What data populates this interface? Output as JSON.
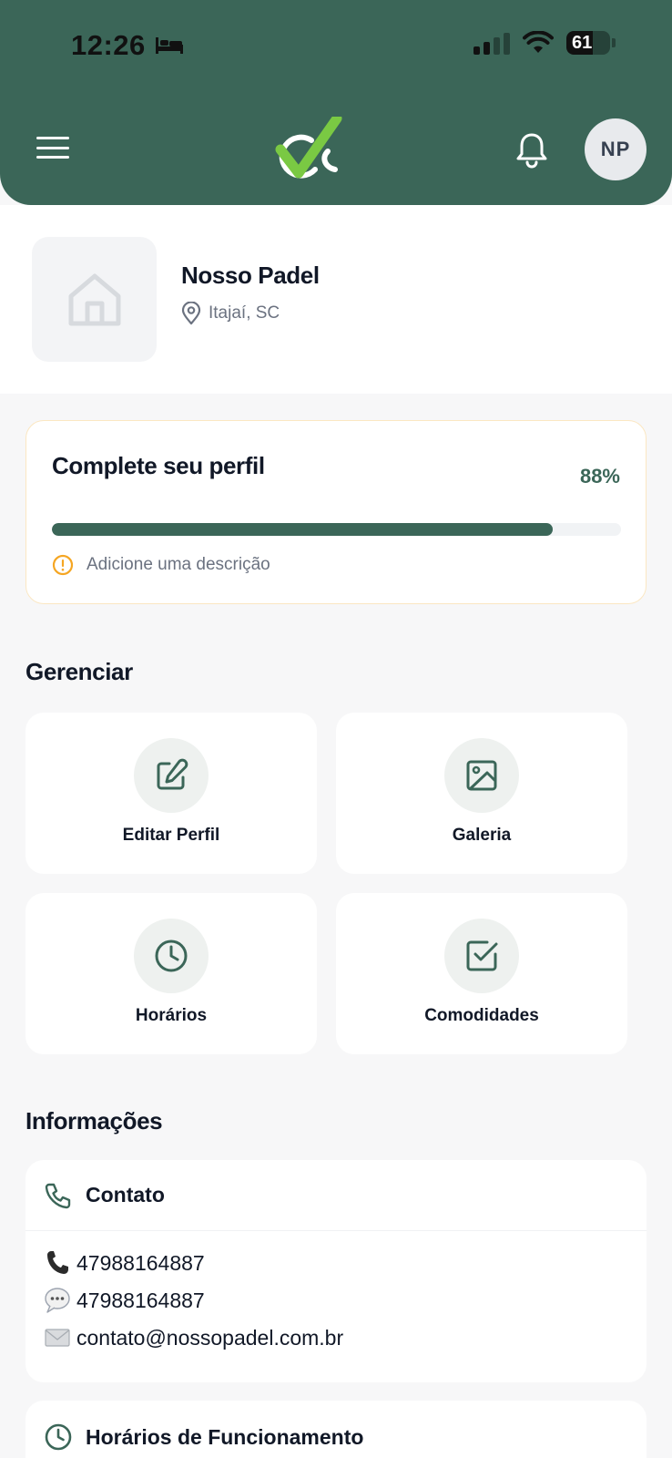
{
  "status_bar": {
    "time": "12:26",
    "battery": "61"
  },
  "header": {
    "avatar_initials": "NP"
  },
  "profile": {
    "name": "Nosso Padel",
    "location": "Itajaí, SC"
  },
  "completion": {
    "title": "Complete seu perfil",
    "percent_label": "88%",
    "percent": 88,
    "hint": "Adicione uma descrição"
  },
  "manage": {
    "title": "Gerenciar",
    "tiles": [
      {
        "label": "Editar Perfil",
        "icon": "edit-icon"
      },
      {
        "label": "Galeria",
        "icon": "image-icon"
      },
      {
        "label": "Horários",
        "icon": "clock-icon"
      },
      {
        "label": "Comodidades",
        "icon": "checkbox-icon"
      }
    ]
  },
  "info": {
    "title": "Informações",
    "contact": {
      "title": "Contato",
      "phone": "47988164887",
      "whatsapp": "47988164887",
      "email": "contato@nossopadel.com.br"
    },
    "hours": {
      "title": "Horários de Funcionamento"
    }
  },
  "colors": {
    "brand": "#3b6658",
    "accent_green": "#7ac943",
    "warning": "#f5a623"
  }
}
